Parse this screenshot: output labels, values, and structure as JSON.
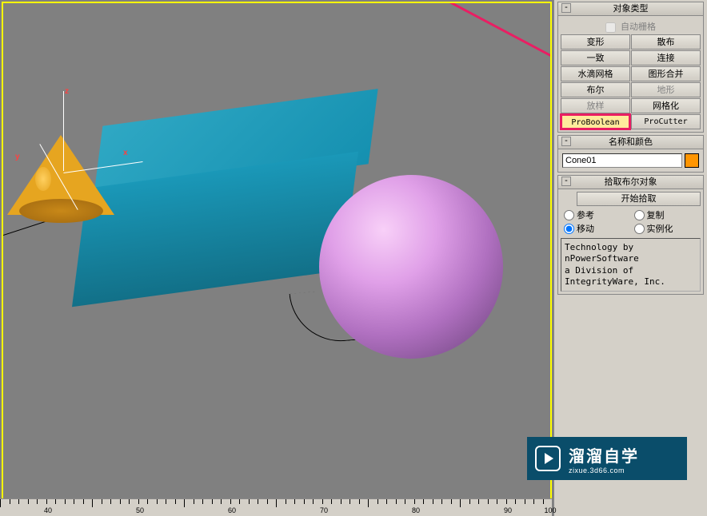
{
  "panel": {
    "object_type": {
      "title": "对象类型",
      "auto_grid": "自动栅格",
      "buttons": [
        {
          "label": "变形"
        },
        {
          "label": "散布"
        },
        {
          "label": "一致"
        },
        {
          "label": "连接"
        },
        {
          "label": "水滴网格"
        },
        {
          "label": "图形合并"
        },
        {
          "label": "布尔"
        },
        {
          "label": "地形",
          "disabled": true
        },
        {
          "label": "放样",
          "disabled": true
        },
        {
          "label": "网格化"
        },
        {
          "label": "ProBoolean",
          "highlighted": true
        },
        {
          "label": "ProCutter"
        }
      ]
    },
    "name_color": {
      "title": "名称和颜色",
      "name_value": "Cone01",
      "color": "#ff9500"
    },
    "pick_boolean": {
      "title": "拾取布尔对象",
      "start_pick": "开始拾取",
      "options": [
        {
          "label": "参考",
          "checked": false
        },
        {
          "label": "复制",
          "checked": false
        },
        {
          "label": "移动",
          "checked": true
        },
        {
          "label": "实例化",
          "checked": false
        }
      ],
      "tech_lines": [
        "Technology by",
        "nPowerSoftware",
        "a Division of",
        "IntegrityWare, Inc."
      ]
    }
  },
  "ruler": {
    "labels": [
      {
        "pos": 60,
        "text": "40"
      },
      {
        "pos": 175,
        "text": "50"
      },
      {
        "pos": 290,
        "text": "60"
      },
      {
        "pos": 405,
        "text": "70"
      },
      {
        "pos": 520,
        "text": "80"
      },
      {
        "pos": 635,
        "text": "90"
      },
      {
        "pos": 688,
        "text": "100"
      }
    ]
  },
  "watermark": {
    "main": "溜溜自学",
    "sub": "zixue.3d66.com"
  },
  "gizmo": {
    "x": "x",
    "y": "y",
    "z": "z"
  }
}
